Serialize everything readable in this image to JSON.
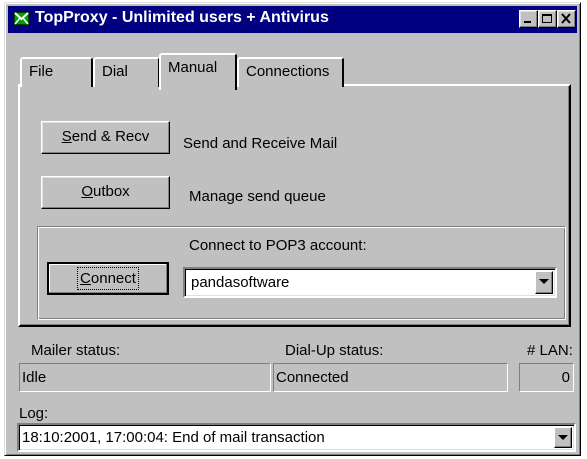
{
  "window": {
    "title": "TopProxy - Unlimited users + Antivirus",
    "icon": "envelope-icon",
    "controls": [
      "minimize",
      "maximize",
      "close"
    ]
  },
  "tabs": [
    {
      "label": "File",
      "active": false
    },
    {
      "label": "Dial",
      "active": false
    },
    {
      "label": "Manual",
      "active": true
    },
    {
      "label": "Connections",
      "active": false
    }
  ],
  "manual": {
    "send_recv": {
      "mnemonic": "S",
      "rest": "end & Recv",
      "description": "Send and Receive Mail"
    },
    "outbox": {
      "mnemonic": "O",
      "rest": "utbox",
      "description": "Manage send queue"
    },
    "pop3": {
      "label": "Connect to POP3 account:",
      "connect": {
        "mnemonic": "C",
        "rest": "onnect"
      },
      "account": "pandasoftware"
    }
  },
  "status": {
    "mailer_label": "Mailer status:",
    "mailer_value": "Idle",
    "dialup_label": "Dial-Up status:",
    "dialup_value": "Connected",
    "lan_label": "# LAN:",
    "lan_value": "0"
  },
  "log": {
    "label": "Log:",
    "value": "18:10:2001, 17:00:04: End of mail transaction"
  }
}
